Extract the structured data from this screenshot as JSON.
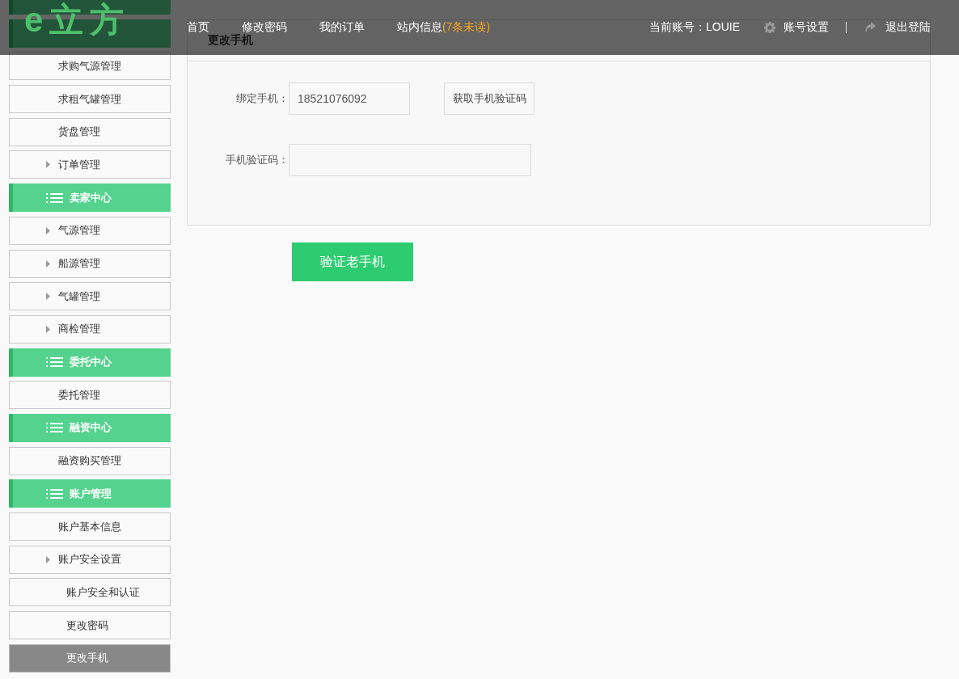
{
  "top_bar": {
    "logo": "e立方",
    "nav": [
      {
        "label": "首页"
      },
      {
        "label": "修改密码"
      },
      {
        "label": "我的订单"
      },
      {
        "label": "站内信息",
        "badge": "(7条未读)"
      }
    ],
    "account": "当前账号：LOUIE",
    "actions": [
      {
        "kind": "settings",
        "label": "账号设置"
      },
      {
        "kind": "logout",
        "label": "退出登陆"
      }
    ]
  },
  "sidebar": {
    "groups": [
      {
        "items": [
          {
            "kind": "link",
            "label": "求购气源管理",
            "selected": false
          },
          {
            "kind": "link",
            "label": "求租气罐管理",
            "selected": false
          },
          {
            "kind": "link",
            "label": "货盘管理",
            "selected": false
          },
          {
            "kind": "expandable",
            "label": "订单管理",
            "selected": false
          }
        ]
      },
      {
        "label": "卖家中心",
        "items": [
          {
            "kind": "expandable",
            "label": "气源管理",
            "selected": false
          },
          {
            "kind": "expandable",
            "label": "船源管理",
            "selected": false
          },
          {
            "kind": "expandable",
            "label": "气罐管理",
            "selected": false
          },
          {
            "kind": "expandable",
            "label": "商检管理",
            "selected": false
          }
        ]
      },
      {
        "label": "委托中心",
        "items": [
          {
            "kind": "link",
            "label": "委托管理",
            "selected": false
          }
        ]
      },
      {
        "label": "融资中心",
        "items": [
          {
            "kind": "link",
            "label": "融资购买管理",
            "selected": false
          }
        ]
      },
      {
        "label": "账户管理",
        "items": [
          {
            "kind": "link",
            "label": "账户基本信息",
            "selected": false
          },
          {
            "kind": "expandable",
            "label": "账户安全设置",
            "selected": false,
            "children": [
              {
                "label": "账户安全和认证",
                "selected": false
              },
              {
                "label": "更改密码",
                "selected": false
              },
              {
                "label": "更改手机",
                "selected": true
              }
            ]
          }
        ]
      }
    ]
  },
  "panel": {
    "title": "更改手机",
    "fields": [
      {
        "label": "绑定手机：",
        "value": "18521076092",
        "button": "获取手机验证码"
      },
      {
        "label": "手机验证码："
      }
    ]
  },
  "submit": "验证老手机"
}
